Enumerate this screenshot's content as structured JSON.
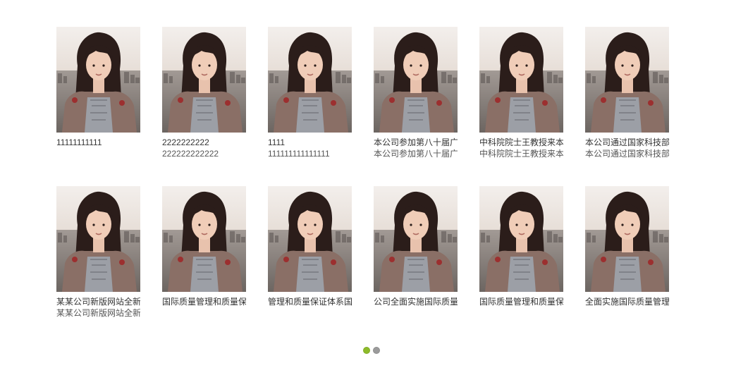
{
  "gallery": {
    "items": [
      {
        "title": "11111111111",
        "subtitle": ""
      },
      {
        "title": "2222222222",
        "subtitle": "222222222222"
      },
      {
        "title": "1111",
        "subtitle": "111111111111111"
      },
      {
        "title": "本公司参加第八十届广",
        "subtitle": "本公司参加第八十届广"
      },
      {
        "title": "中科院院士王教授来本",
        "subtitle": "中科院院士王教授来本"
      },
      {
        "title": "本公司通过国家科技部",
        "subtitle": "本公司通过国家科技部"
      },
      {
        "title": "某某公司新版网站全新",
        "subtitle": "某某公司新版网站全新"
      },
      {
        "title": "国际质量管理和质量保",
        "subtitle": ""
      },
      {
        "title": "管理和质量保证体系国",
        "subtitle": ""
      },
      {
        "title": "公司全面实施国际质量",
        "subtitle": ""
      },
      {
        "title": "国际质量管理和质量保",
        "subtitle": ""
      },
      {
        "title": "全面实施国际质量管理",
        "subtitle": ""
      }
    ]
  },
  "pagination": {
    "active_color": "#8dbb2a",
    "inactive_color": "#9b9b9b",
    "active_index": 0,
    "count": 2
  }
}
